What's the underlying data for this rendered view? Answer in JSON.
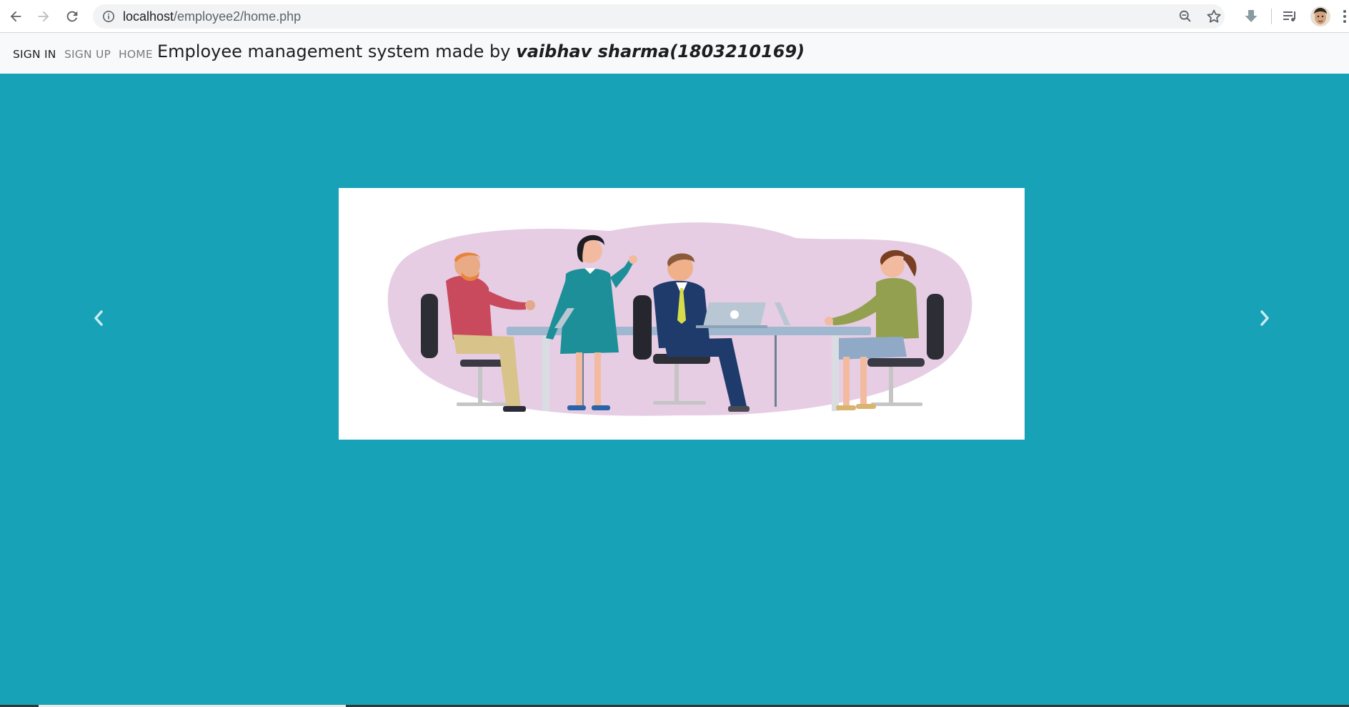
{
  "browser": {
    "url_host": "localhost",
    "url_path": "/employee2/home.php"
  },
  "navbar": {
    "links": [
      {
        "label": "SIGN IN"
      },
      {
        "label": "SIGN UP"
      },
      {
        "label": "HOME"
      }
    ],
    "brand_prefix": "Employee management system made by ",
    "brand_author": "vaibhav sharma(1803210169)"
  },
  "colors": {
    "page_background": "#17a2b8",
    "navbar_background": "#f8f9fa",
    "slide_blob": "#e6cde4"
  },
  "carousel": {
    "prev_icon": "chevron-left-icon",
    "next_icon": "chevron-right-icon",
    "slide_illustration": "team-meeting-illustration"
  }
}
